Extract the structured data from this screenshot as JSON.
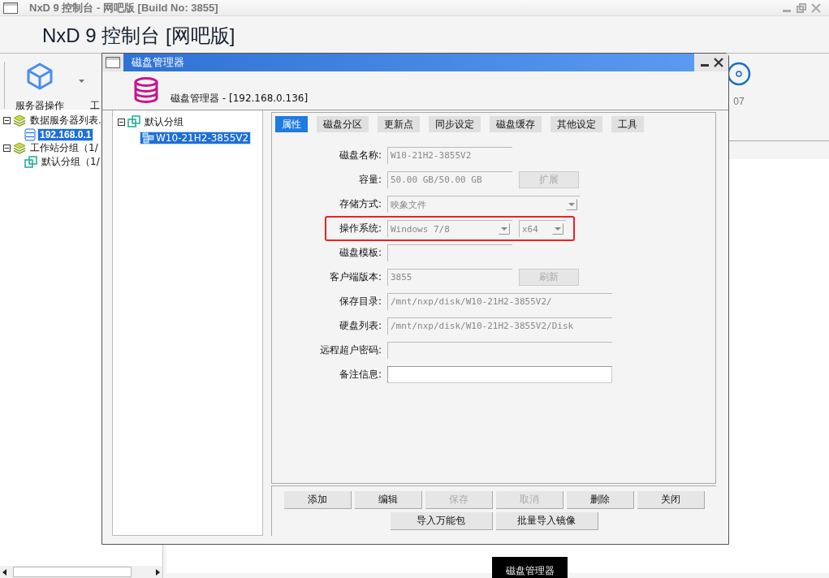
{
  "window": {
    "title": "NxD 9 控制台 - 网吧版 [Build No: 3855]"
  },
  "app_title": "NxD 9 控制台 [网吧版]",
  "toolbar": [
    {
      "label": "服务器操作",
      "kind": "cube",
      "has_menu": true
    },
    {
      "label": "工",
      "kind": "none",
      "has_menu": false
    }
  ],
  "toolbar_right": {
    "label": "07",
    "kind": "dial"
  },
  "server_tree": [
    {
      "label": "数据服务器列表.",
      "kind": "layers",
      "expanded": true,
      "selected": false,
      "children": [
        {
          "label": "192.168.0.1",
          "kind": "server",
          "selected": true
        }
      ]
    },
    {
      "label": "工作站分组（1/",
      "kind": "layers",
      "expanded": true,
      "selected": false,
      "children": [
        {
          "label": "默认分组（1/",
          "kind": "group",
          "selected": false
        }
      ]
    }
  ],
  "tooltip": "磁盘管理器",
  "dialog": {
    "title": "磁盘管理器",
    "header": "磁盘管理器 - [192.168.0.136]",
    "tree": [
      {
        "label": "默认分组",
        "kind": "group",
        "expanded": true,
        "selected": false,
        "children": [
          {
            "label": "W10-21H2-3855V2",
            "kind": "network",
            "selected": true
          }
        ]
      }
    ],
    "tabs": [
      {
        "label": "属性",
        "selected": true
      },
      {
        "label": "磁盘分区",
        "selected": false
      },
      {
        "label": "更新点",
        "selected": false
      },
      {
        "label": "同步设定",
        "selected": false
      },
      {
        "label": "磁盘缓存",
        "selected": false
      },
      {
        "label": "其他设定",
        "selected": false
      },
      {
        "label": "工具",
        "selected": false
      }
    ],
    "fields": [
      {
        "label": "磁盘名称:",
        "kind": "text",
        "value": "W10-21H2-3855V2",
        "editable": false,
        "highlighted": false
      },
      {
        "label": "容量:",
        "kind": "text",
        "value": "50.00 GB/50.00 GB",
        "editable": false,
        "highlighted": false,
        "button": {
          "label": "扩展",
          "disabled": true
        }
      },
      {
        "label": "存储方式:",
        "kind": "combo",
        "value": "映象文件",
        "editable": false,
        "highlighted": false
      },
      {
        "label": "操作系统:",
        "kind": "combo_pair",
        "value": "Windows 7/8",
        "value2": "x64",
        "editable": false,
        "highlighted": true
      },
      {
        "label": "磁盘模板:",
        "kind": "text",
        "editable": false,
        "highlighted": false
      },
      {
        "label": "客户端版本:",
        "kind": "text",
        "value": "3855",
        "editable": false,
        "highlighted": false,
        "button": {
          "label": "刷新",
          "disabled": true
        }
      },
      {
        "label": "保存目录:",
        "kind": "path",
        "value": "/mnt/nxp/disk/W10-21H2-3855V2/",
        "editable": false,
        "highlighted": false
      },
      {
        "label": "硬盘列表:",
        "kind": "path",
        "value": "/mnt/nxp/disk/W10-21H2-3855V2/Disk",
        "editable": false,
        "highlighted": false
      },
      {
        "label": "远程超户密码:",
        "kind": "path",
        "editable": false,
        "highlighted": false
      },
      {
        "label": "备注信息:",
        "kind": "path",
        "editable": true,
        "highlighted": false
      }
    ],
    "buttons": [
      {
        "label": "添加",
        "disabled": false
      },
      {
        "label": "编辑",
        "disabled": false
      },
      {
        "label": "保存",
        "disabled": true
      },
      {
        "label": "取消",
        "disabled": true
      },
      {
        "label": "删除",
        "disabled": false
      },
      {
        "label": "关闭",
        "disabled": false
      }
    ],
    "buttons_row2": [
      {
        "label": "导入万能包",
        "disabled": false
      },
      {
        "label": "批量导入镜像",
        "disabled": false
      }
    ]
  }
}
